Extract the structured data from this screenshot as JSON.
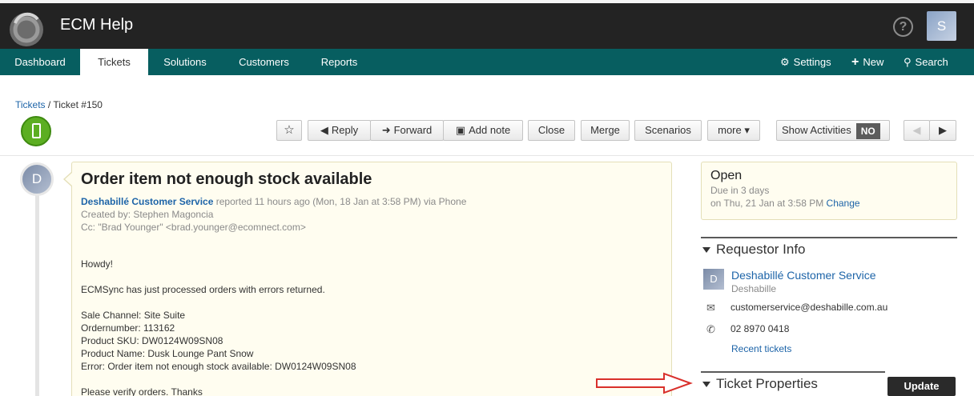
{
  "app": {
    "title": "ECM Help",
    "user_initial": "S",
    "help_glyph": "?"
  },
  "nav": {
    "items": [
      {
        "label": "Dashboard"
      },
      {
        "label": "Tickets"
      },
      {
        "label": "Solutions"
      },
      {
        "label": "Customers"
      },
      {
        "label": "Reports"
      }
    ],
    "right": {
      "settings": "Settings",
      "new": "New",
      "search": "Search"
    }
  },
  "breadcrumb": {
    "parent": "Tickets",
    "sep": "/",
    "current": "Ticket #150"
  },
  "toolbar": {
    "reply": "Reply",
    "forward": "Forward",
    "add_note": "Add note",
    "close": "Close",
    "merge": "Merge",
    "scenarios": "Scenarios",
    "more": "more ▾",
    "show_activities": "Show Activities",
    "toggle_state": "NO"
  },
  "ticket": {
    "avatar_initial": "D",
    "title": "Order item not enough stock available",
    "requester": "Deshabillé Customer Service",
    "reported": " reported 11 hours ago (Mon, 18 Jan at 3:58 PM) via Phone",
    "created_by": "Created by: Stephen Magoncia",
    "cc": "Cc: \"Brad Younger\" <brad.younger@ecomnect.com>",
    "body": [
      "Howdy!",
      "ECMSync has just processed orders with errors returned.",
      "Sale Channel: Site Suite",
      "Ordernumber: 113162",
      "Product SKU: DW0124W09SN08",
      "Product Name: Dusk Lounge Pant Snow",
      "Error: Order item not enough stock available: DW0124W09SN08",
      "Please verify orders. Thanks"
    ]
  },
  "status": {
    "state": "Open",
    "due": "Due in 3 days",
    "due_date": "on Thu, 21 Jan at 3:58 PM ",
    "change": "Change"
  },
  "requestor": {
    "heading": "Requestor Info",
    "avatar_initial": "D",
    "name": "Deshabillé Customer Service",
    "company": "Deshabille",
    "email": "customerservice@deshabille.com.au",
    "phone": "02 8970 0418",
    "recent": "Recent tickets"
  },
  "properties": {
    "heading": "Ticket Properties",
    "update": "Update"
  },
  "colors": {
    "nav": "#075e60",
    "topbar": "#232323",
    "link": "#1d64a8",
    "annotation": "#d9302b"
  }
}
